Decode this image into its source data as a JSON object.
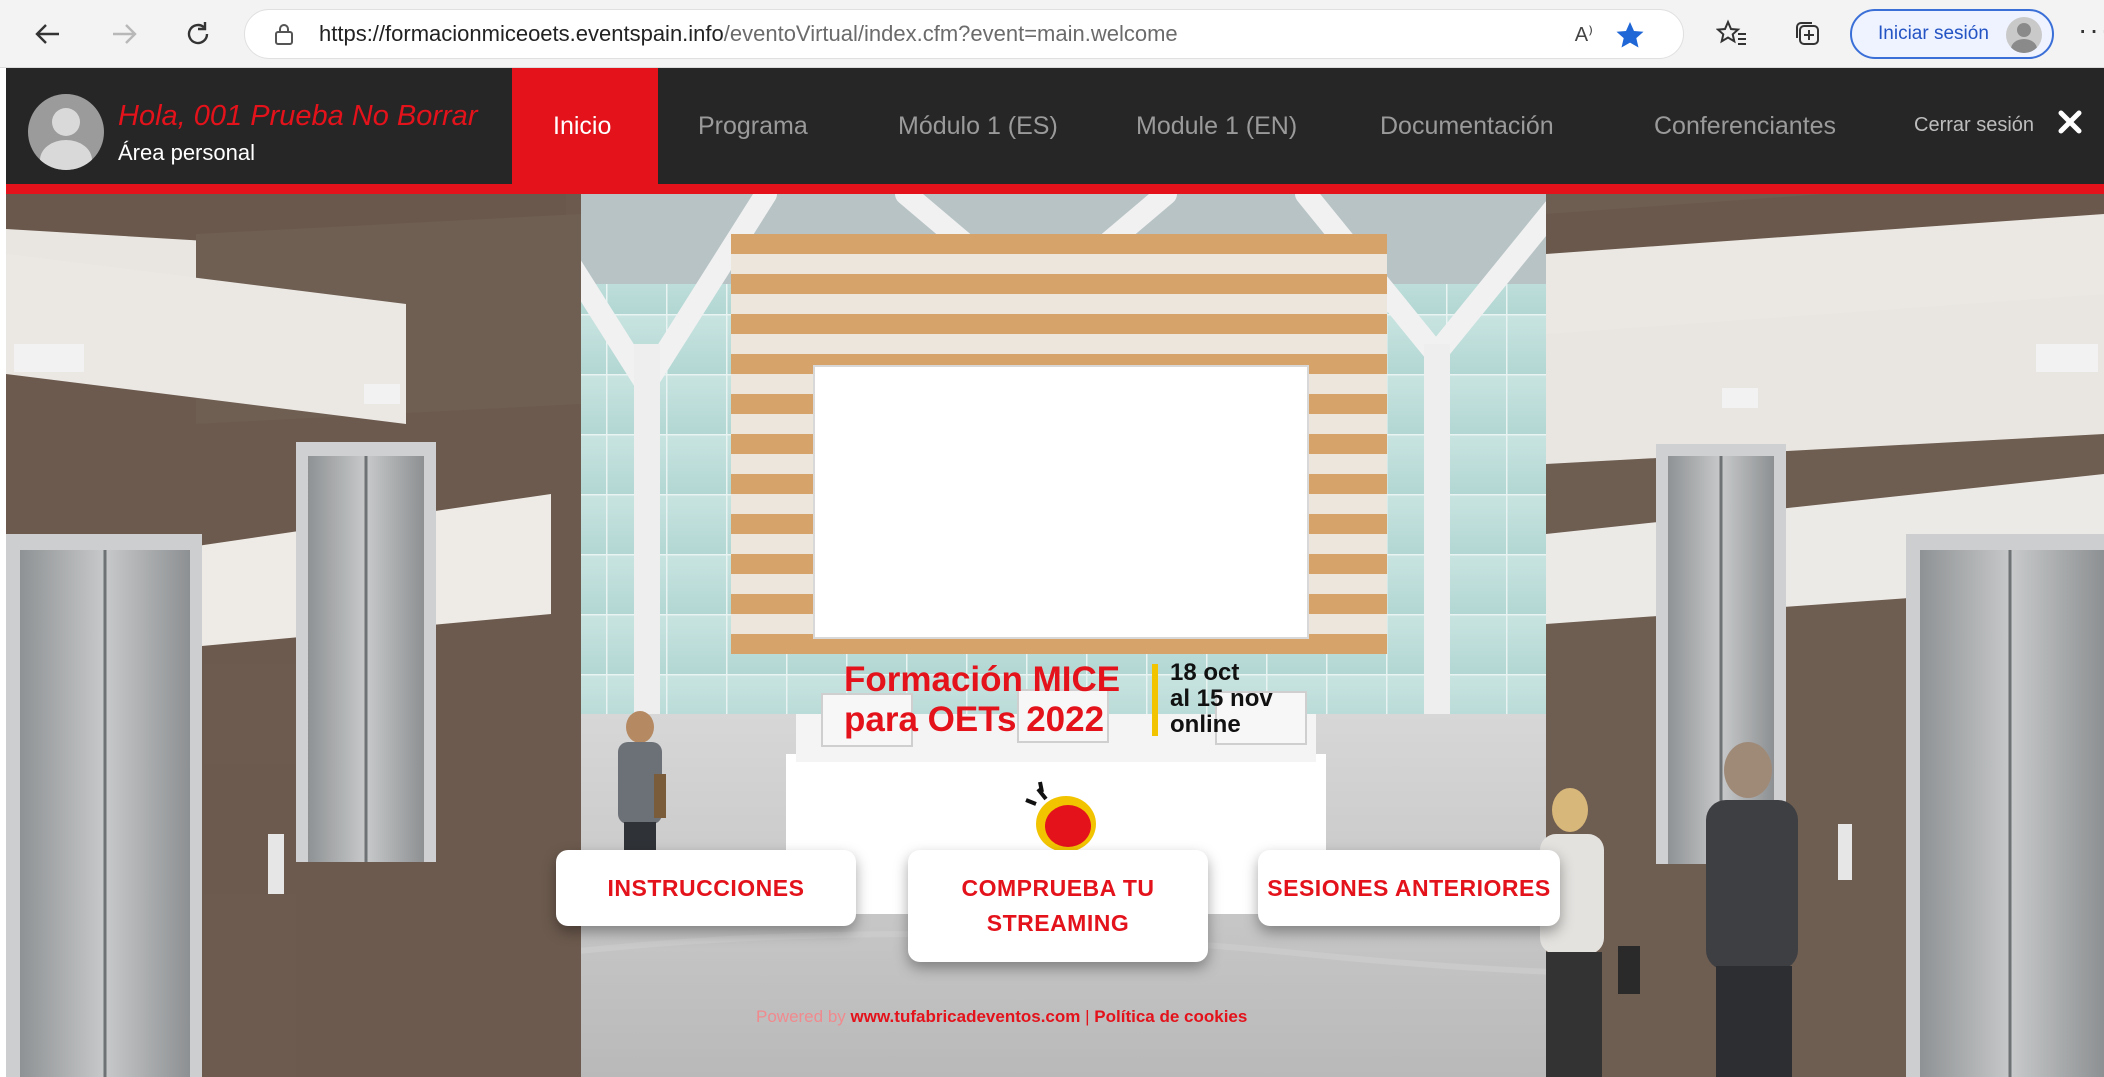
{
  "browser": {
    "url_host": "https://formacionmiceoets.eventspain.info",
    "url_path": "/eventoVirtual/index.cfm?event=main.welcome",
    "read_aloud_icon": "A⁾",
    "signin_label": "Iniciar sesión",
    "more_label": "···",
    "icons": [
      "back-icon",
      "forward-icon",
      "refresh-icon",
      "lock-icon",
      "read-aloud-icon",
      "star-icon",
      "favorites-icon",
      "collections-icon",
      "profile-icon",
      "more-icon"
    ]
  },
  "header": {
    "greeting": "Hola, 001 Prueba No Borrar",
    "subtitle": "Área personal",
    "menu": [
      "Inicio",
      "Programa",
      "Módulo 1 (ES)",
      "Module 1 (EN)",
      "Documentación",
      "Conferenciantes"
    ],
    "logout": "Cerrar sesión",
    "accent_color": "#e3121b",
    "bar_color": "#262626"
  },
  "banner": {
    "title_line1": "Formación MICE",
    "title_line2": "para OETs 2022",
    "date_line1": "18 oct",
    "date_line2": "al 15 nov",
    "date_line3": "online"
  },
  "buttons": {
    "instructions": "INSTRUCCIONES",
    "streaming_line1": "COMPRUEBA TU",
    "streaming_line2": "STREAMING",
    "previous": "SESIONES ANTERIORES"
  },
  "footer": {
    "powered": "Powered by",
    "site": "www.tufabricadeventos.com",
    "sep": "|",
    "cookies": "Política de cookies"
  }
}
